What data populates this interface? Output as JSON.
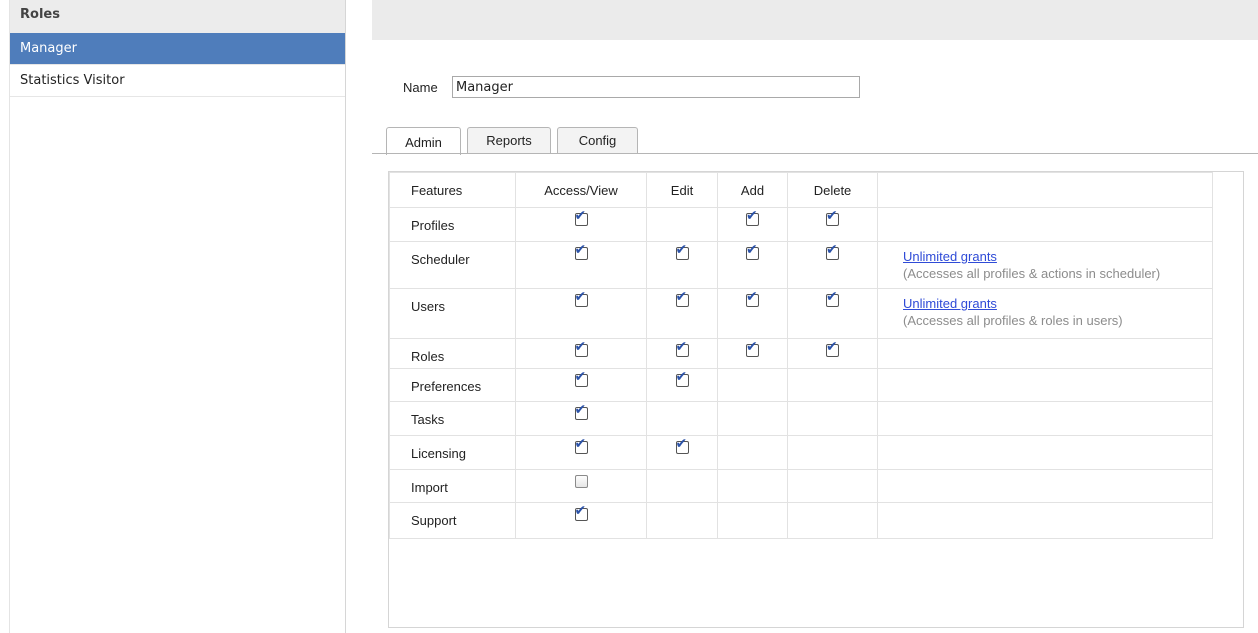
{
  "sidebar": {
    "title": "Roles",
    "items": [
      {
        "label": "Manager",
        "selected": true
      },
      {
        "label": "Statistics Visitor",
        "selected": false
      }
    ]
  },
  "form": {
    "name_label": "Name",
    "name_value": "Manager"
  },
  "tabs": [
    {
      "label": "Admin",
      "active": true
    },
    {
      "label": "Reports",
      "active": false
    },
    {
      "label": "Config",
      "active": false
    }
  ],
  "table": {
    "headers": [
      "Features",
      "Access/View",
      "Edit",
      "Add",
      "Delete",
      ""
    ],
    "rows": [
      {
        "feature": "Profiles",
        "access": true,
        "edit": null,
        "add": true,
        "delete": true,
        "link": "",
        "desc": ""
      },
      {
        "feature": "Scheduler",
        "access": true,
        "edit": true,
        "add": true,
        "delete": true,
        "link": "Unlimited grants",
        "desc": "(Accesses all profiles & actions in scheduler)"
      },
      {
        "feature": "Users",
        "access": true,
        "edit": true,
        "add": true,
        "delete": true,
        "link": "Unlimited grants",
        "desc": "(Accesses all profiles & roles in users)"
      },
      {
        "feature": "Roles",
        "access": true,
        "edit": true,
        "add": true,
        "delete": true,
        "link": "",
        "desc": ""
      },
      {
        "feature": "Preferences",
        "access": true,
        "edit": true,
        "add": null,
        "delete": null,
        "link": "",
        "desc": ""
      },
      {
        "feature": "Tasks",
        "access": true,
        "edit": null,
        "add": null,
        "delete": null,
        "link": "",
        "desc": ""
      },
      {
        "feature": "Licensing",
        "access": true,
        "edit": true,
        "add": null,
        "delete": null,
        "link": "",
        "desc": ""
      },
      {
        "feature": "Import",
        "access": false,
        "edit": null,
        "add": null,
        "delete": null,
        "link": "",
        "desc": ""
      },
      {
        "feature": "Support",
        "access": true,
        "edit": null,
        "add": null,
        "delete": null,
        "link": "",
        "desc": ""
      }
    ]
  },
  "colors": {
    "selected_bg": "#4f7dbb",
    "link": "#2f4bd7",
    "checkmark": "#2b52a8"
  }
}
